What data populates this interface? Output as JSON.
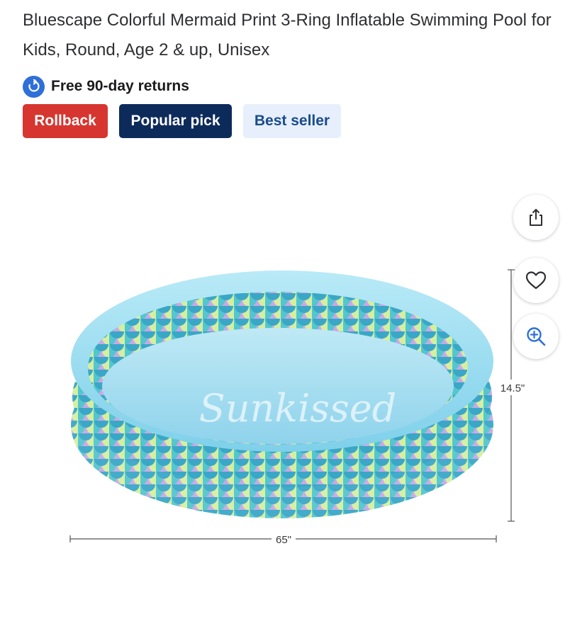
{
  "product": {
    "title": "Bluescape Colorful Mermaid Print 3-Ring Inflatable Swimming Pool for Kids, Round, Age 2 & up, Unisex",
    "returns_text": "Free 90-day returns",
    "badges": {
      "rollback": "Rollback",
      "popular": "Popular pick",
      "best_seller": "Best seller"
    }
  },
  "image": {
    "width_label": "65\"",
    "height_label": "14.5\"",
    "pool_text": "Sunkissed"
  },
  "actions": {
    "share_icon": "share-icon",
    "favorite_icon": "heart-icon",
    "zoom_icon": "zoom-in-icon"
  },
  "colors": {
    "rollback": "#d7352f",
    "popular": "#0d2b5a",
    "best_seller_bg": "#e6effb",
    "returns_icon": "#2e6fd8"
  }
}
